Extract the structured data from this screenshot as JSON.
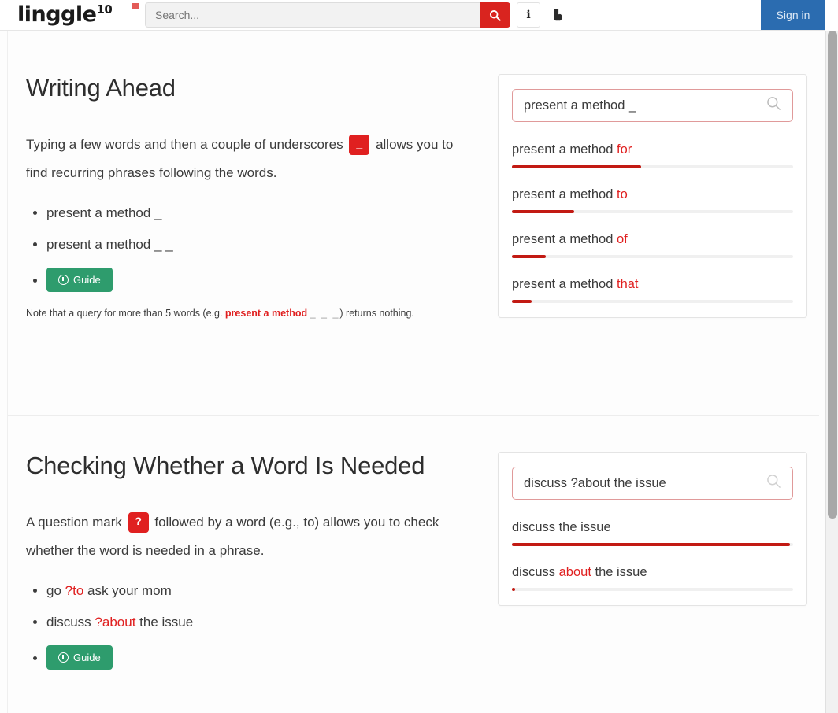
{
  "header": {
    "brand": "linggle",
    "brand_sup": "10",
    "search_placeholder": "Search...",
    "search_value": "",
    "search_button_icon": "search-icon",
    "info_button_label": "i",
    "hand_icon": "hand-pointer-icon",
    "signin_label": "Sign in",
    "accent_red": "#d9241f",
    "accent_blue": "#2b6cb0"
  },
  "sections": [
    {
      "title": "Writing Ahead",
      "paragraph_before": "Typing a few words and then a couple of underscores",
      "badge": "_",
      "paragraph_after": "allows you to find recurring phrases following the words.",
      "examples": [
        {
          "plain": "present a method _"
        },
        {
          "plain": "present a method _ _"
        }
      ],
      "guide_button": "Guide",
      "note_prefix": "Note that a query for more than 5 words (e.g.",
      "note_bold": "present a method",
      "note_dim": "_ _ _",
      "note_suffix": ") returns nothing.",
      "card": {
        "query": "present a method _",
        "results": [
          {
            "prefix": "present a method ",
            "highlight": "for",
            "percent": 46
          },
          {
            "prefix": "present a method ",
            "highlight": "to",
            "percent": 22
          },
          {
            "prefix": "present a method ",
            "highlight": "of",
            "percent": 12
          },
          {
            "prefix": "present a method ",
            "highlight": "that",
            "percent": 7
          }
        ]
      }
    },
    {
      "title": "Checking Whether a Word Is Needed",
      "paragraph_before": "A question mark",
      "badge": "?",
      "paragraph_after": "followed by a word (e.g., to) allows you to check whether the word is needed in a phrase.",
      "examples": [
        {
          "prefix": "go ",
          "highlight": "?to",
          "suffix": " ask your mom"
        },
        {
          "prefix": "discuss ",
          "highlight": "?about",
          "suffix": " the issue"
        }
      ],
      "guide_button": "Guide",
      "card": {
        "query": "discuss ?about the issue",
        "results": [
          {
            "prefix": "discuss the issue",
            "highlight": "",
            "suffix": "",
            "percent": 99
          },
          {
            "prefix": "discuss ",
            "highlight": "about",
            "suffix": " the issue",
            "percent": 1
          }
        ]
      }
    }
  ],
  "colors": {
    "bar_fill": "#c21a13",
    "bar_track": "#f0f0f0",
    "badge_red": "#e02020",
    "guide_green": "#2e9c6d"
  }
}
